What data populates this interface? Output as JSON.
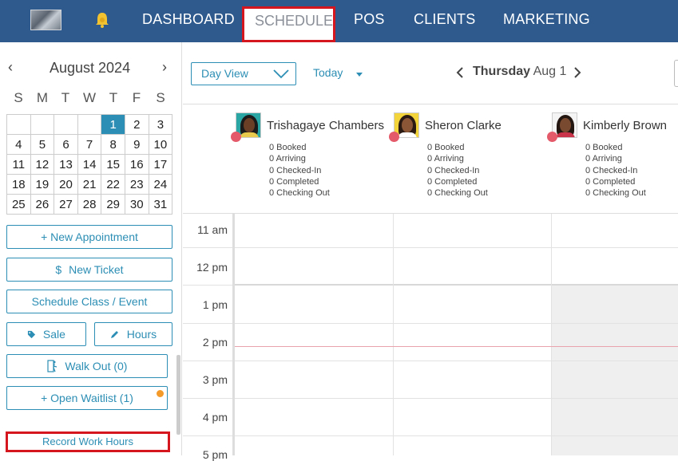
{
  "nav": {
    "items": [
      "DASHBOARD",
      "SCHEDULE",
      "POS",
      "CLIENTS",
      "MARKETING"
    ],
    "active": "SCHEDULE"
  },
  "calendar": {
    "month_title": "August 2024",
    "days_of_week": [
      "S",
      "M",
      "T",
      "W",
      "T",
      "F",
      "S"
    ],
    "weeks": [
      [
        "",
        "",
        "",
        "",
        "1",
        "2",
        "3"
      ],
      [
        "4",
        "5",
        "6",
        "7",
        "8",
        "9",
        "10"
      ],
      [
        "11",
        "12",
        "13",
        "14",
        "15",
        "16",
        "17"
      ],
      [
        "18",
        "19",
        "20",
        "21",
        "22",
        "23",
        "24"
      ],
      [
        "25",
        "26",
        "27",
        "28",
        "29",
        "30",
        "31"
      ]
    ],
    "selected_day": "1"
  },
  "sidebar": {
    "new_appointment": "+ New Appointment",
    "new_ticket": "New Ticket",
    "new_ticket_icon": "$",
    "schedule_class": "Schedule Class / Event",
    "sale": "Sale",
    "hours": "Hours",
    "walk_out": "Walk Out (0)",
    "open_waitlist": "+ Open Waitlist (1)",
    "record_work_hours": "Record Work Hours"
  },
  "toolbar": {
    "view": "Day View",
    "today": "Today",
    "day_name": "Thursday",
    "date": "Aug 1"
  },
  "staff": [
    {
      "name": "Trishagaye Chambers",
      "booked": "0 Booked",
      "arriving": "0 Arriving",
      "checked_in": "0 Checked-In",
      "completed": "0 Completed",
      "checking_out": "0 Checking Out"
    },
    {
      "name": "Sheron Clarke",
      "booked": "0 Booked",
      "arriving": "0 Arriving",
      "checked_in": "0 Checked-In",
      "completed": "0 Completed",
      "checking_out": "0 Checking Out"
    },
    {
      "name": "Kimberly Brown",
      "booked": "0 Booked",
      "arriving": "0 Arriving",
      "checked_in": "0 Checked-In",
      "completed": "0 Completed",
      "checking_out": "0 Checking Out"
    }
  ],
  "hours": [
    "11 am",
    "12 pm",
    "1 pm",
    "2 pm",
    "3 pm",
    "4 pm",
    "5 pm"
  ],
  "colors": {
    "nav_bg": "#2e5a8e",
    "accent": "#2c8eb4",
    "highlight_red": "#d6161f",
    "waitlist_dot": "#f39a2a"
  }
}
